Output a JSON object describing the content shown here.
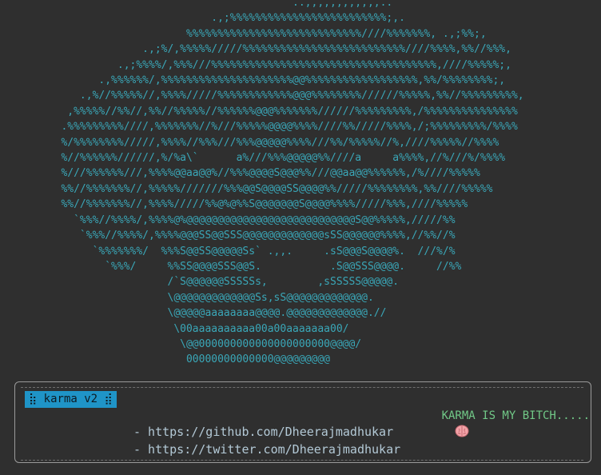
{
  "ascii_art": "                                              ..,,,,,,,,,,,,..\n                                 .,;%%%%%%%%%%%%%%%%%%%%%%%%%;,.\n                             %%%%%%%%%%%%%%%%%%%%%%%%%%%%////%%%%%%%, .,;%%;,\n                      .,;%/,%%%%%/////%%%%%%%%%%%%%%%%%%%%%%%%%%////%%%%,%%//%%%,\n                  .,;%%%%/,%%%///%%%%%%%%%%%%%%%%%%%%%%%%%%%%%%%%%%%%,////%%%%%;,\n               .,%%%%%%/,%%%%%%%%%%%%%%%%%%%%%@@%%%%%%%%%%%%%%%%%%,%%/%%%%%%%%;,\n            .,%//%%%%%//,%%%%/////%%%%%%%%%%%%@@@%%%%%%%%//////%%%%%,%%//%%%%%%%%%,\n          ,%%%%%//%%//,%%//%%%%%//%%%%%%@@@%%%%%%%//////%%%%%%%%%,/%%%%%%%%%%%%%%%\n         .%%%%%%%%%////,%%%%%%%//%///%%%%%@@@@%%%%////%%/////%%%%,/;%%%%%%%%%/%%%%\n         %/%%%%%%%%/////,%%%%//%%%///%%%@@@@@%%%%///%%/%%%%%//%,////%%%%%//%%%%\n         %//%%%%%%//////,%/%a\\`      a%///%%%@@@@@%%////a     a%%%%,//%///%/%%%%\n         %///%%%%%%///,%%%%@@aa@@%//%%%@@@@S@@@%%///@@aa@@%%%%%%,/%////%%%%%\n         %%//%%%%%%%//,%%%%%///////%%%@@S@@@@SS@@@@%%/////%%%%%%%%,%%////%%%%%\n         %%//%%%%%%%//,%%%%/////%%@%@%%S@@@@@@@S@@@@%%%%/////%%%,////%%%%%\n           `%%%//%%%%/,%%%%@%@@@@@@@@@@@@@@@@@@@@@@@@@@@S@@%%%%%,/////%%\n            `%%%//%%%%/,%%%%@@@SS@@SSS@@@@@@@@@@@@@sSS@@@@@@%%%%,//%%//%\n              `%%%%%%%/  %%%S@@SS@@@@@Ss` .,,.     .sS@@@S@@@@%.  ///%/%\n                `%%%/     %%SS@@@@SSS@@S.           .S@@SSS@@@@.     //%%\n                          /`S@@@@@@SSSSSs,        ,sSSSSS@@@@@.\n                          \\@@@@@@@@@@@@@Ss,sS@@@@@@@@@@@@@.\n                          \\@@@@@aaaaaaaa@@@@.@@@@@@@@@@@@@.//\n                           \\00aaaaaaaaaa00a00aaaaaaa00/\n                            \\@@000000000000000000000@@@@/\n                             00000000000000@@@@@@@@@",
  "info_box": {
    "badge": "⣷ karma v2 ⣾",
    "slogan": "KARMA IS MY BITCH.....",
    "slogan_icon": "brain-icon",
    "links": [
      "- https://github.com/Dheerajmadhukar",
      "- https://twitter.com/Dheerajmadhukar"
    ]
  },
  "colors": {
    "background": "#2f2f2f",
    "art": "#3aa7b8",
    "badge_bg": "#1f94c7",
    "slogan": "#71c887",
    "links": "#b3c9d6"
  }
}
